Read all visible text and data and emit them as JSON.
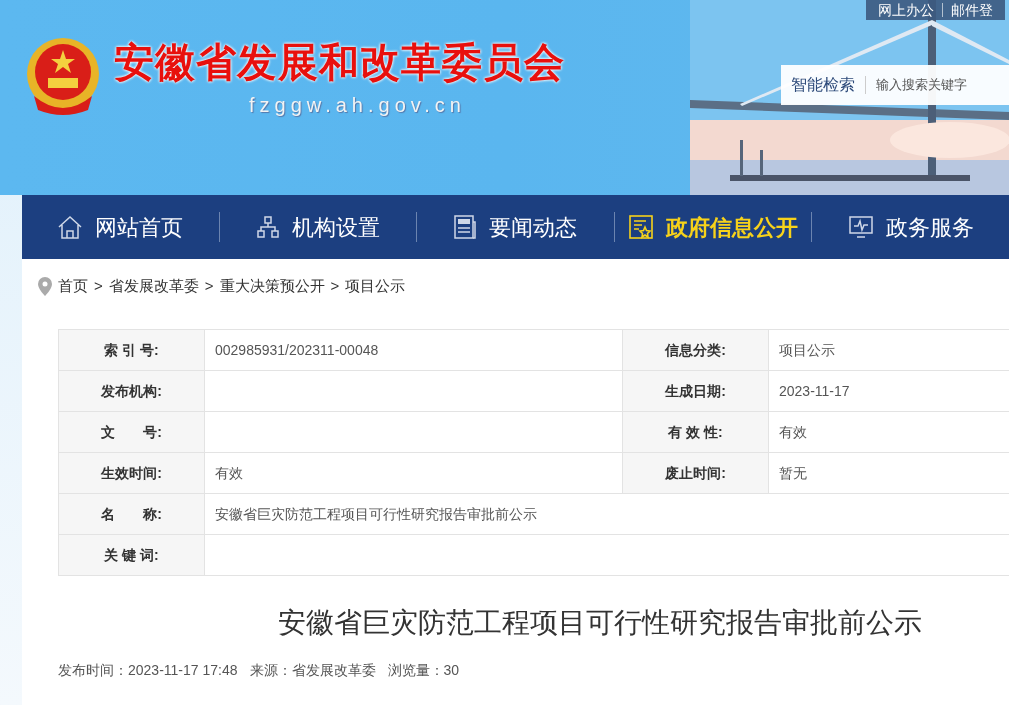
{
  "header": {
    "title": "安徽省发展和改革委员会",
    "domain": "fzggw.ah.gov.cn",
    "top_links": [
      "网上办公",
      "邮件登"
    ],
    "search": {
      "button": "智能检索",
      "placeholder": "输入搜索关键字"
    }
  },
  "nav": [
    {
      "label": "网站首页",
      "selected": false
    },
    {
      "label": "机构设置",
      "selected": false
    },
    {
      "label": "要闻动态",
      "selected": false
    },
    {
      "label": "政府信息公开",
      "selected": true
    },
    {
      "label": "政务服务",
      "selected": false
    }
  ],
  "breadcrumb": {
    "separator": ">",
    "items": [
      "首页",
      "省发展改革委",
      "重大决策预公开",
      "项目公示"
    ]
  },
  "info_table": {
    "rows": [
      [
        {
          "label": "索 引 号:",
          "value": "002985931/202311-00048"
        },
        {
          "label": "信息分类:",
          "value": "项目公示"
        }
      ],
      [
        {
          "label": "发布机构:"
        },
        {
          "label": "生成日期:",
          "value": "2023-11-17"
        }
      ],
      [
        {
          "label": "文　　号:"
        },
        {
          "label": "有 效 性:",
          "value": "有效"
        }
      ],
      [
        {
          "label": "生效时间:",
          "value": "有效"
        },
        {
          "label": "废止时间:",
          "value": "暂无"
        }
      ],
      [
        {
          "label": "名　　称:",
          "value": "安徽省巨灾防范工程项目可行性研究报告审批前公示"
        }
      ],
      [
        {
          "label": "关 键 词:"
        }
      ]
    ]
  },
  "article": {
    "title": "安徽省巨灾防范工程项目可行性研究报告审批前公示",
    "meta": [
      {
        "label": "发布时间：",
        "value": "2023-11-17 17:48"
      },
      {
        "label": "来源：",
        "value": "省发展改革委"
      },
      {
        "label": "浏览量：",
        "value": "30"
      }
    ]
  }
}
